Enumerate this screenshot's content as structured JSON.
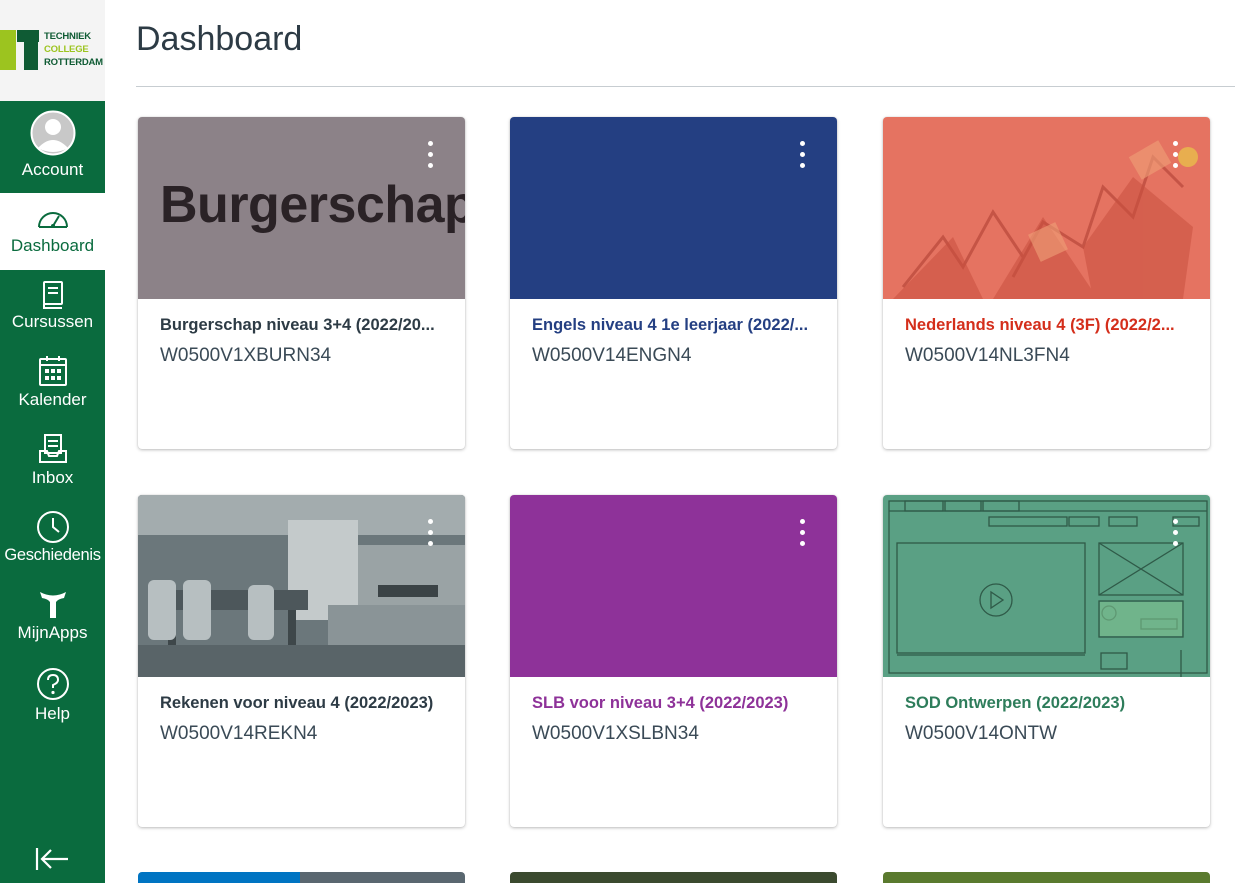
{
  "logo": {
    "line1": "TECHNIEK",
    "line2": "COLLEGE",
    "line3": "ROTTERDAM"
  },
  "sidebar": {
    "items": [
      {
        "label": "Account",
        "icon": "avatar-icon"
      },
      {
        "label": "Dashboard",
        "icon": "speedometer-icon"
      },
      {
        "label": "Cursussen",
        "icon": "book-icon"
      },
      {
        "label": "Kalender",
        "icon": "calendar-icon"
      },
      {
        "label": "Inbox",
        "icon": "inbox-icon"
      },
      {
        "label": "Geschiedenis",
        "icon": "clock-icon"
      },
      {
        "label": "MijnApps",
        "icon": "apps-logo-icon"
      },
      {
        "label": "Help",
        "icon": "help-icon"
      }
    ],
    "collapse_icon": "collapse-arrow-icon"
  },
  "page": {
    "title": "Dashboard"
  },
  "courses": [
    {
      "name": "Burgerschap niveau 3+4 (2022/20...",
      "code": "W0500V1XBURN34",
      "color": "#8c8288",
      "name_color": "#2d3b45",
      "hero_text": "Burgerschap"
    },
    {
      "name": "Engels niveau 4 1e leerjaar (2022/...",
      "code": "W0500V14ENGN4",
      "color": "#243f82",
      "name_color": "#243f82"
    },
    {
      "name": "Nederlands niveau 4 (3F) (2022/2...",
      "code": "W0500V14NL3FN4",
      "color": "#e57361",
      "name_color": "#d42e1b"
    },
    {
      "name": "Rekenen voor niveau 4 (2022/2023)",
      "code": "W0500V14REKN4",
      "color": "#5c6a70",
      "name_color": "#2d3b45"
    },
    {
      "name": "SLB voor niveau 3+4 (2022/2023)",
      "code": "W0500V1XSLBN34",
      "color": "#8e3299",
      "name_color": "#8e3299"
    },
    {
      "name": "SOD Ontwerpen (2022/2023)",
      "code": "W0500V14ONTW",
      "color": "#5aa084",
      "name_color": "#2e7d5b"
    }
  ],
  "peek_colors": [
    "#0074c2",
    "#3b4a2f",
    "#5a7a2e"
  ]
}
